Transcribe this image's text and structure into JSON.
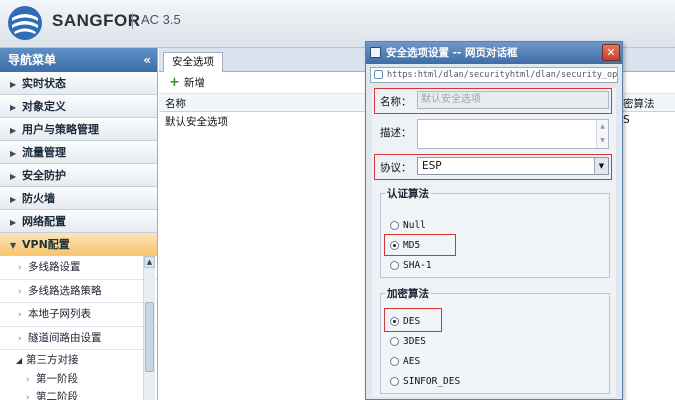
{
  "header": {
    "brand": "SANGFOR",
    "version": "AC 3.5"
  },
  "sidebar": {
    "title": "导航菜单",
    "collapse": "«",
    "items": [
      {
        "label": "实时状态"
      },
      {
        "label": "对象定义"
      },
      {
        "label": "用户与策略管理"
      },
      {
        "label": "流量管理"
      },
      {
        "label": "安全防护"
      },
      {
        "label": "防火墙"
      },
      {
        "label": "网络配置"
      },
      {
        "label": "VPN配置"
      }
    ],
    "vpn_sub": [
      {
        "label": "多线路设置"
      },
      {
        "label": "多线路选路策略"
      },
      {
        "label": "本地子网列表"
      },
      {
        "label": "隧道间路由设置"
      }
    ],
    "group": {
      "label": "第三方对接"
    },
    "group_children": [
      {
        "label": "第一阶段"
      },
      {
        "label": "第二阶段"
      }
    ]
  },
  "main": {
    "tab": "安全选项",
    "add_label": "新增",
    "columns": {
      "name": "名称",
      "partial": "密算法"
    },
    "rows": [
      {
        "name": "默认安全选项",
        "partial": "S"
      }
    ]
  },
  "dialog": {
    "title": "安全选项设置 -- 网页对话框",
    "close": "✕",
    "url": "https:html/dlan/securityhtml/dlan/security_op",
    "name_label": "名称：",
    "name_value": "默认安全选项",
    "desc_label": "描述：",
    "protocol_label": "协议：",
    "protocol_value": "ESP",
    "auth_legend": "认证算法",
    "auth_options": [
      {
        "label": "Null",
        "selected": false
      },
      {
        "label": "MD5",
        "selected": true
      },
      {
        "label": "SHA-1",
        "selected": false
      }
    ],
    "enc_legend": "加密算法",
    "enc_options": [
      {
        "label": "DES",
        "selected": true
      },
      {
        "label": "3DES",
        "selected": false
      },
      {
        "label": "AES",
        "selected": false
      },
      {
        "label": "SINFOR_DES",
        "selected": false
      }
    ]
  },
  "colors": {
    "highlight": "#d43636",
    "accent": "#3c6ea9",
    "nav_open": "#f7c56f"
  }
}
